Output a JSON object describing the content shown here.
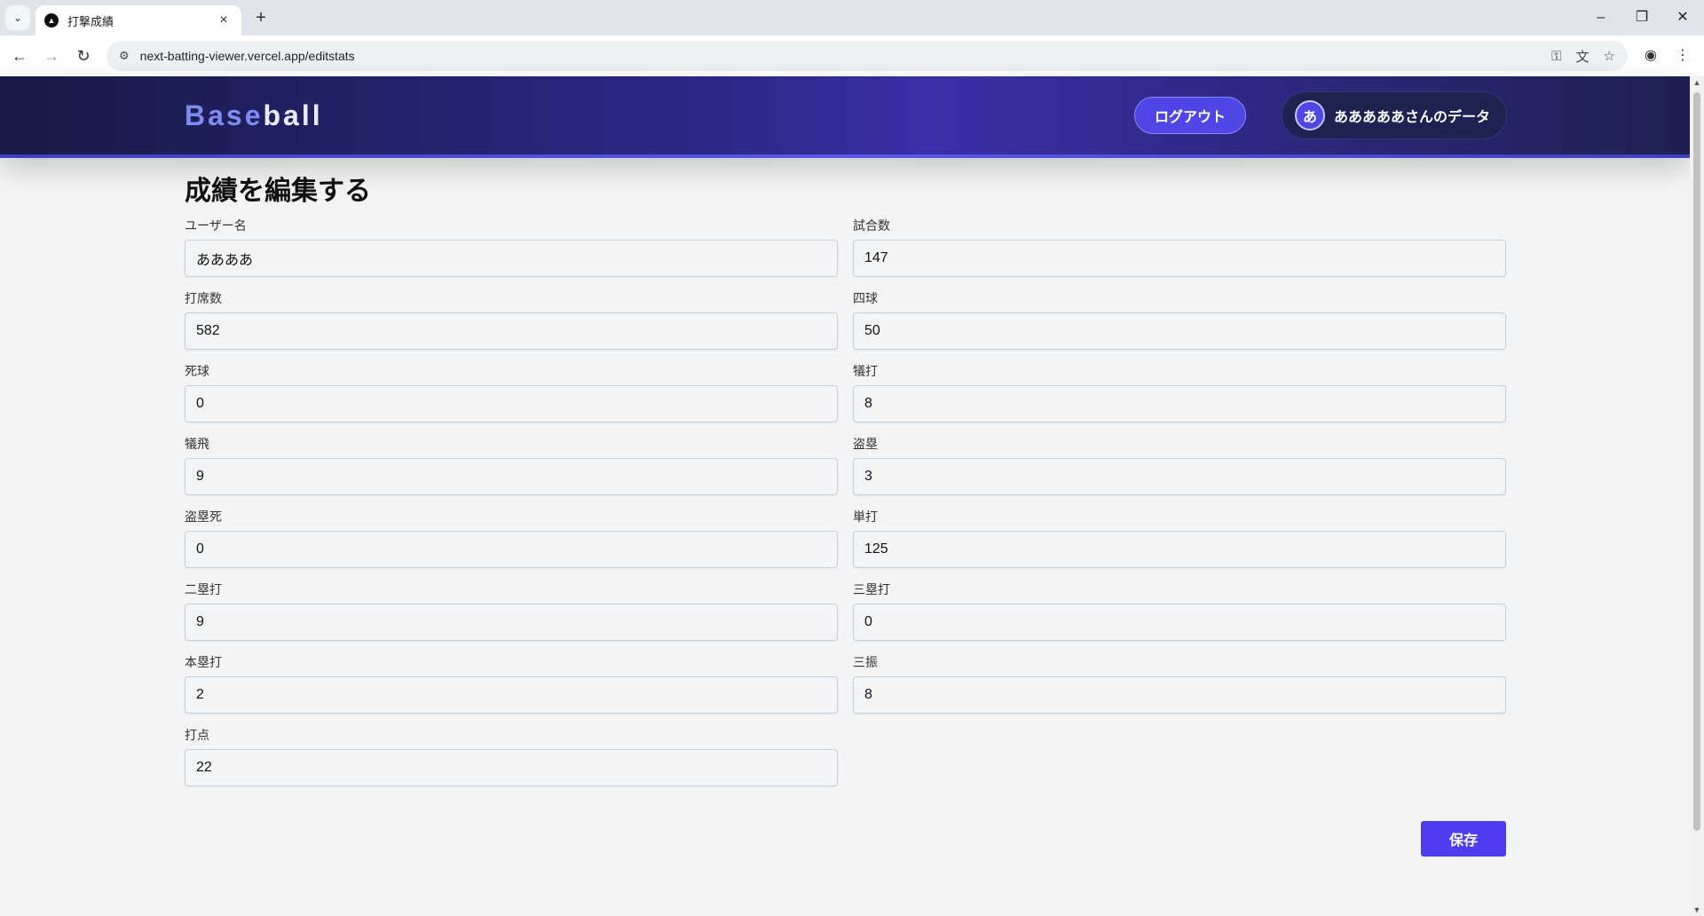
{
  "browser": {
    "tab_title": "打撃成績",
    "url": "next-batting-viewer.vercel.app/editstats",
    "icons": {
      "tab_menu": "chevron-down-icon",
      "favicon": "vercel-triangle-icon",
      "close": "close-icon",
      "new_tab": "plus-icon",
      "back": "arrow-left-icon",
      "forward": "arrow-right-icon",
      "reload": "reload-icon",
      "site_info": "tune-icon",
      "password": "key-icon",
      "translate": "translate-icon",
      "bookmark": "star-icon",
      "profile": "account-icon",
      "menu": "more-vert-icon"
    }
  },
  "header": {
    "brand_part1": "Base",
    "brand_part2": "ball",
    "logout_label": "ログアウト",
    "avatar_initial": "あ",
    "user_label": "あああああさんのデータ"
  },
  "main": {
    "title": "成績を編集する",
    "fields": [
      {
        "label": "ユーザー名",
        "value": "ああああ"
      },
      {
        "label": "試合数",
        "value": "147"
      },
      {
        "label": "打席数",
        "value": "582"
      },
      {
        "label": "四球",
        "value": "50"
      },
      {
        "label": "死球",
        "value": "0"
      },
      {
        "label": "犠打",
        "value": "8"
      },
      {
        "label": "犠飛",
        "value": "9"
      },
      {
        "label": "盗塁",
        "value": "3"
      },
      {
        "label": "盗塁死",
        "value": "0"
      },
      {
        "label": "単打",
        "value": "125"
      },
      {
        "label": "二塁打",
        "value": "9"
      },
      {
        "label": "三塁打",
        "value": "0"
      },
      {
        "label": "本塁打",
        "value": "2"
      },
      {
        "label": "三振",
        "value": "8"
      },
      {
        "label": "打点",
        "value": "22"
      }
    ],
    "save_label": "保存"
  },
  "colors": {
    "accent": "#4f3cf0",
    "header_dark": "#171a45",
    "page_bg": "#f3f4f6"
  }
}
